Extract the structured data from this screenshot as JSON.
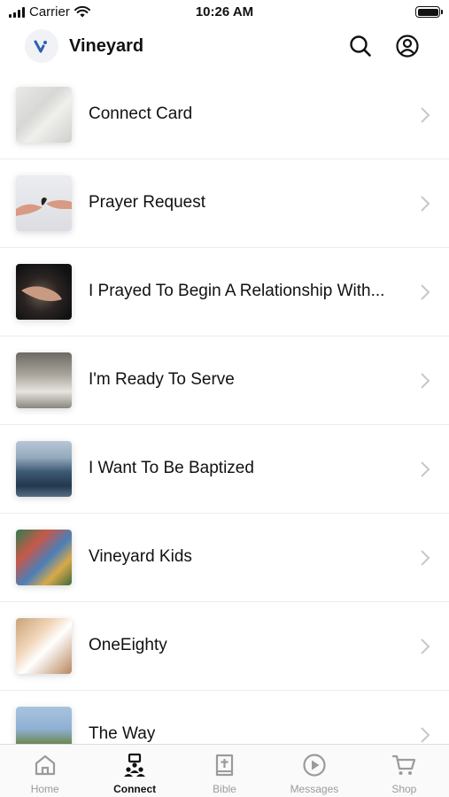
{
  "status_bar": {
    "carrier": "Carrier",
    "time": "10:26 AM"
  },
  "header": {
    "title": "Vineyard",
    "search_icon": "search-icon",
    "profile_icon": "profile-icon"
  },
  "items": [
    {
      "label": "Connect Card",
      "thumb": "t-connect"
    },
    {
      "label": "Prayer Request",
      "thumb": "t-prayer"
    },
    {
      "label": "I Prayed To Begin A Relationship With...",
      "thumb": "t-relationship"
    },
    {
      "label": "I'm Ready To Serve",
      "thumb": "t-serve"
    },
    {
      "label": "I Want To Be Baptized",
      "thumb": "t-baptized"
    },
    {
      "label": "Vineyard Kids",
      "thumb": "t-kids"
    },
    {
      "label": "OneEighty",
      "thumb": "t-oneeighty"
    },
    {
      "label": "The Way",
      "thumb": "t-theway"
    }
  ],
  "tabs": [
    {
      "label": "Home",
      "icon": "home-icon",
      "active": false
    },
    {
      "label": "Connect",
      "icon": "connect-icon",
      "active": true
    },
    {
      "label": "Bible",
      "icon": "bible-icon",
      "active": false
    },
    {
      "label": "Messages",
      "icon": "play-icon",
      "active": false
    },
    {
      "label": "Shop",
      "icon": "cart-icon",
      "active": false
    }
  ],
  "colors": {
    "accent": "#2f5fb3",
    "active_tab": "#111111",
    "inactive_tab": "#9b9b9b"
  }
}
